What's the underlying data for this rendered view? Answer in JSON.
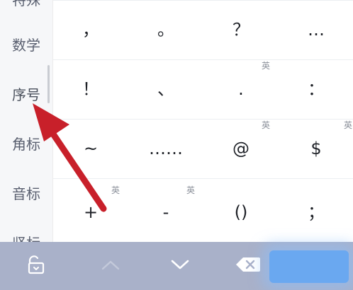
{
  "sidebar": {
    "items": [
      {
        "label": "特殊"
      },
      {
        "label": "数学"
      },
      {
        "label": "序号"
      },
      {
        "label": "角标"
      },
      {
        "label": "音标"
      },
      {
        "label": "竖标"
      }
    ]
  },
  "grid": {
    "rows": [
      [
        {
          "symbol": "，",
          "tag": ""
        },
        {
          "symbol": "。",
          "tag": ""
        },
        {
          "symbol": "？",
          "tag": ""
        },
        {
          "symbol": "…",
          "tag": ""
        }
      ],
      [
        {
          "symbol": "！",
          "tag": ""
        },
        {
          "symbol": "、",
          "tag": ""
        },
        {
          "symbol": ".",
          "tag": "英"
        },
        {
          "symbol": "：",
          "tag": ""
        }
      ],
      [
        {
          "symbol": "~",
          "tag": ""
        },
        {
          "symbol": "……",
          "tag": ""
        },
        {
          "symbol": "@",
          "tag": "英"
        },
        {
          "symbol": "$",
          "tag": "英"
        }
      ],
      [
        {
          "symbol": "+",
          "tag": "英"
        },
        {
          "symbol": "-",
          "tag": "英"
        },
        {
          "symbol": "()",
          "tag": ""
        },
        {
          "symbol": "；",
          "tag": ""
        }
      ]
    ]
  },
  "toolbar": {
    "icons": [
      "lock-icon",
      "chevron-up-icon",
      "chevron-down-icon",
      "backspace-icon"
    ],
    "confirm_color": "#6aa8f0"
  },
  "colors": {
    "annotation_arrow": "#c8202a",
    "toolbar_bg": "#a9b1c9"
  }
}
